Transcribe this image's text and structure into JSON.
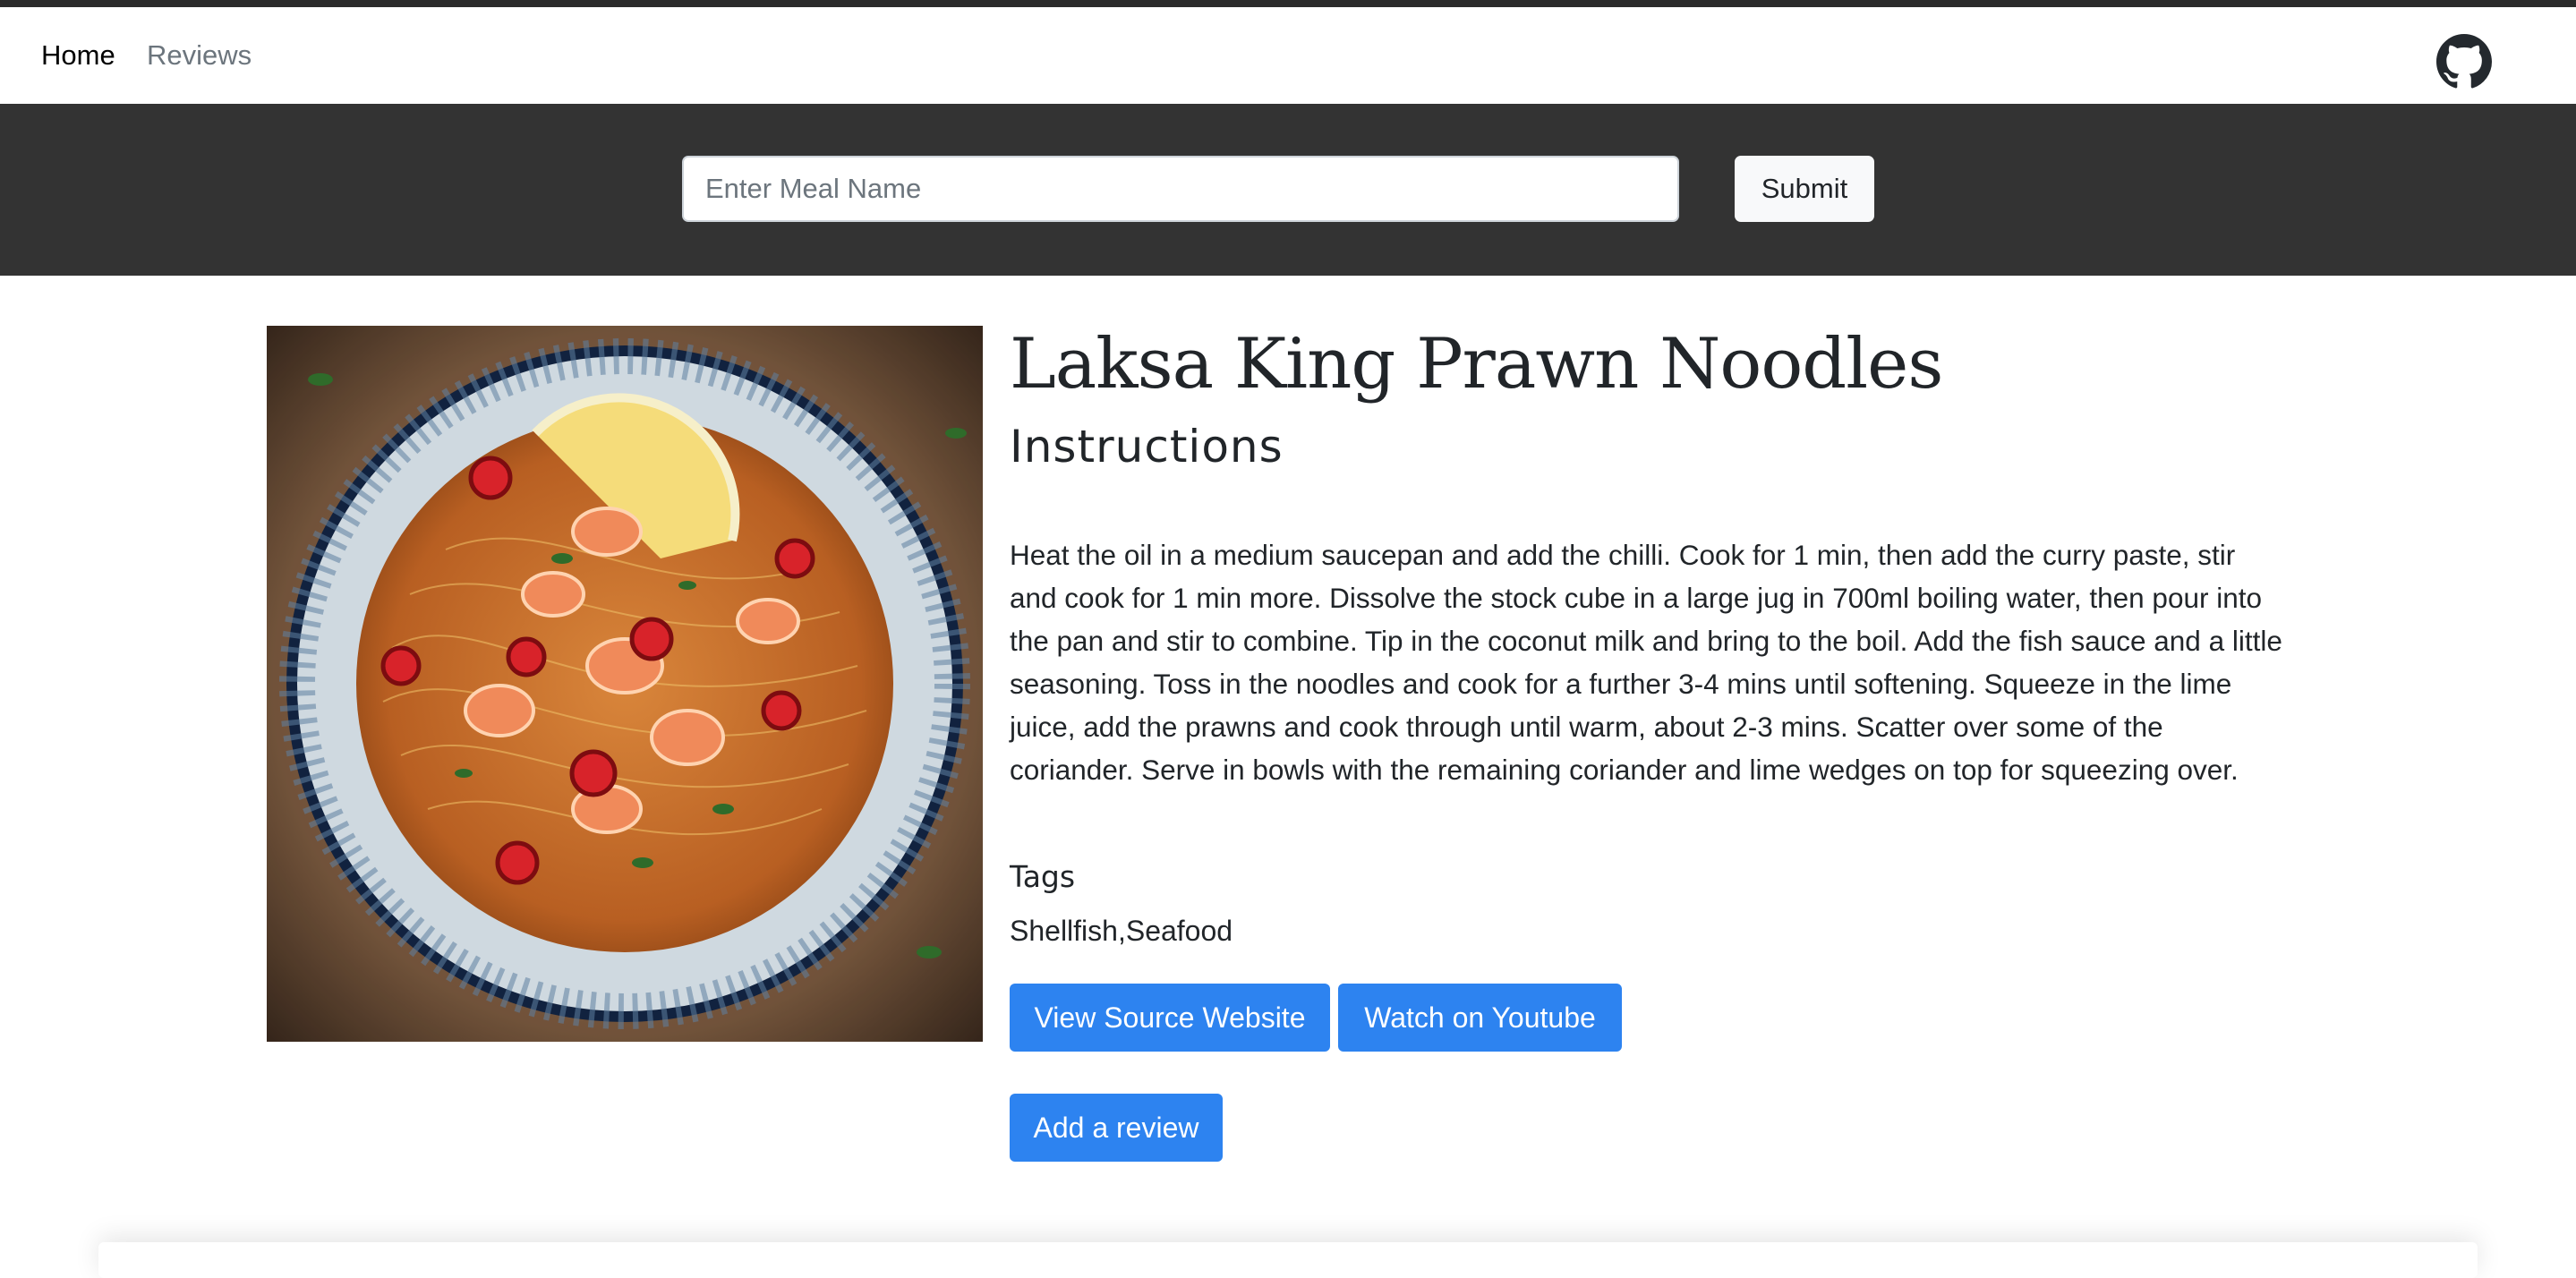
{
  "nav": {
    "home_label": "Home",
    "reviews_label": "Reviews",
    "github_icon": "github-icon"
  },
  "search": {
    "placeholder": "Enter Meal Name",
    "value": "",
    "submit_label": "Submit"
  },
  "meal": {
    "title": "Laksa King Prawn Noodles",
    "instructions_heading": "Instructions",
    "instructions": "Heat the oil in a medium saucepan and add the chilli. Cook for 1 min, then add the curry paste, stir and cook for 1 min more. Dissolve the stock cube in a large jug in 700ml boiling water, then pour into the pan and stir to combine. Tip in the coconut milk and bring to the boil. Add the fish sauce and a little seasoning. Toss in the noodles and cook for a further 3-4 mins until softening. Squeeze in the lime juice, add the prawns and cook through until warm, about 2-3 mins. Scatter over some of the coriander. Serve in bowls with the remaining coriander and lime wedges on top for squeezing over.",
    "tags_label": "Tags",
    "tags": "Shellfish,Seafood",
    "photo_icon": "noodle-bowl-photo"
  },
  "actions": {
    "source_label": "View Source Website",
    "youtube_label": "Watch on Youtube",
    "review_label": "Add a review"
  },
  "colors": {
    "header_bg": "#333333",
    "primary": "#2d83f0",
    "nav_muted": "#6c757d"
  }
}
